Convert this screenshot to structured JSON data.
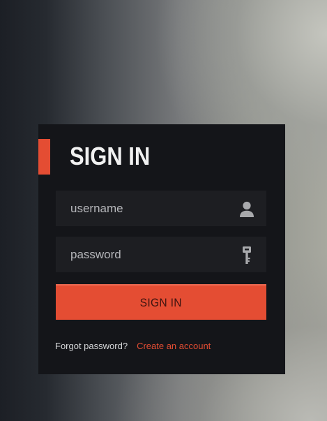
{
  "login": {
    "title": "SIGN IN",
    "username": {
      "placeholder": "username",
      "value": "",
      "icon": "user-icon"
    },
    "password": {
      "placeholder": "password",
      "value": "",
      "icon": "key-icon"
    },
    "submit_label": "SIGN IN",
    "forgot_label": "Forgot password?",
    "create_label": "Create an account"
  },
  "colors": {
    "panel": "#141519",
    "field": "#1d1e22",
    "accent": "#e44d33",
    "title": "#f1f1f1",
    "icon": "#a8a9ac"
  }
}
